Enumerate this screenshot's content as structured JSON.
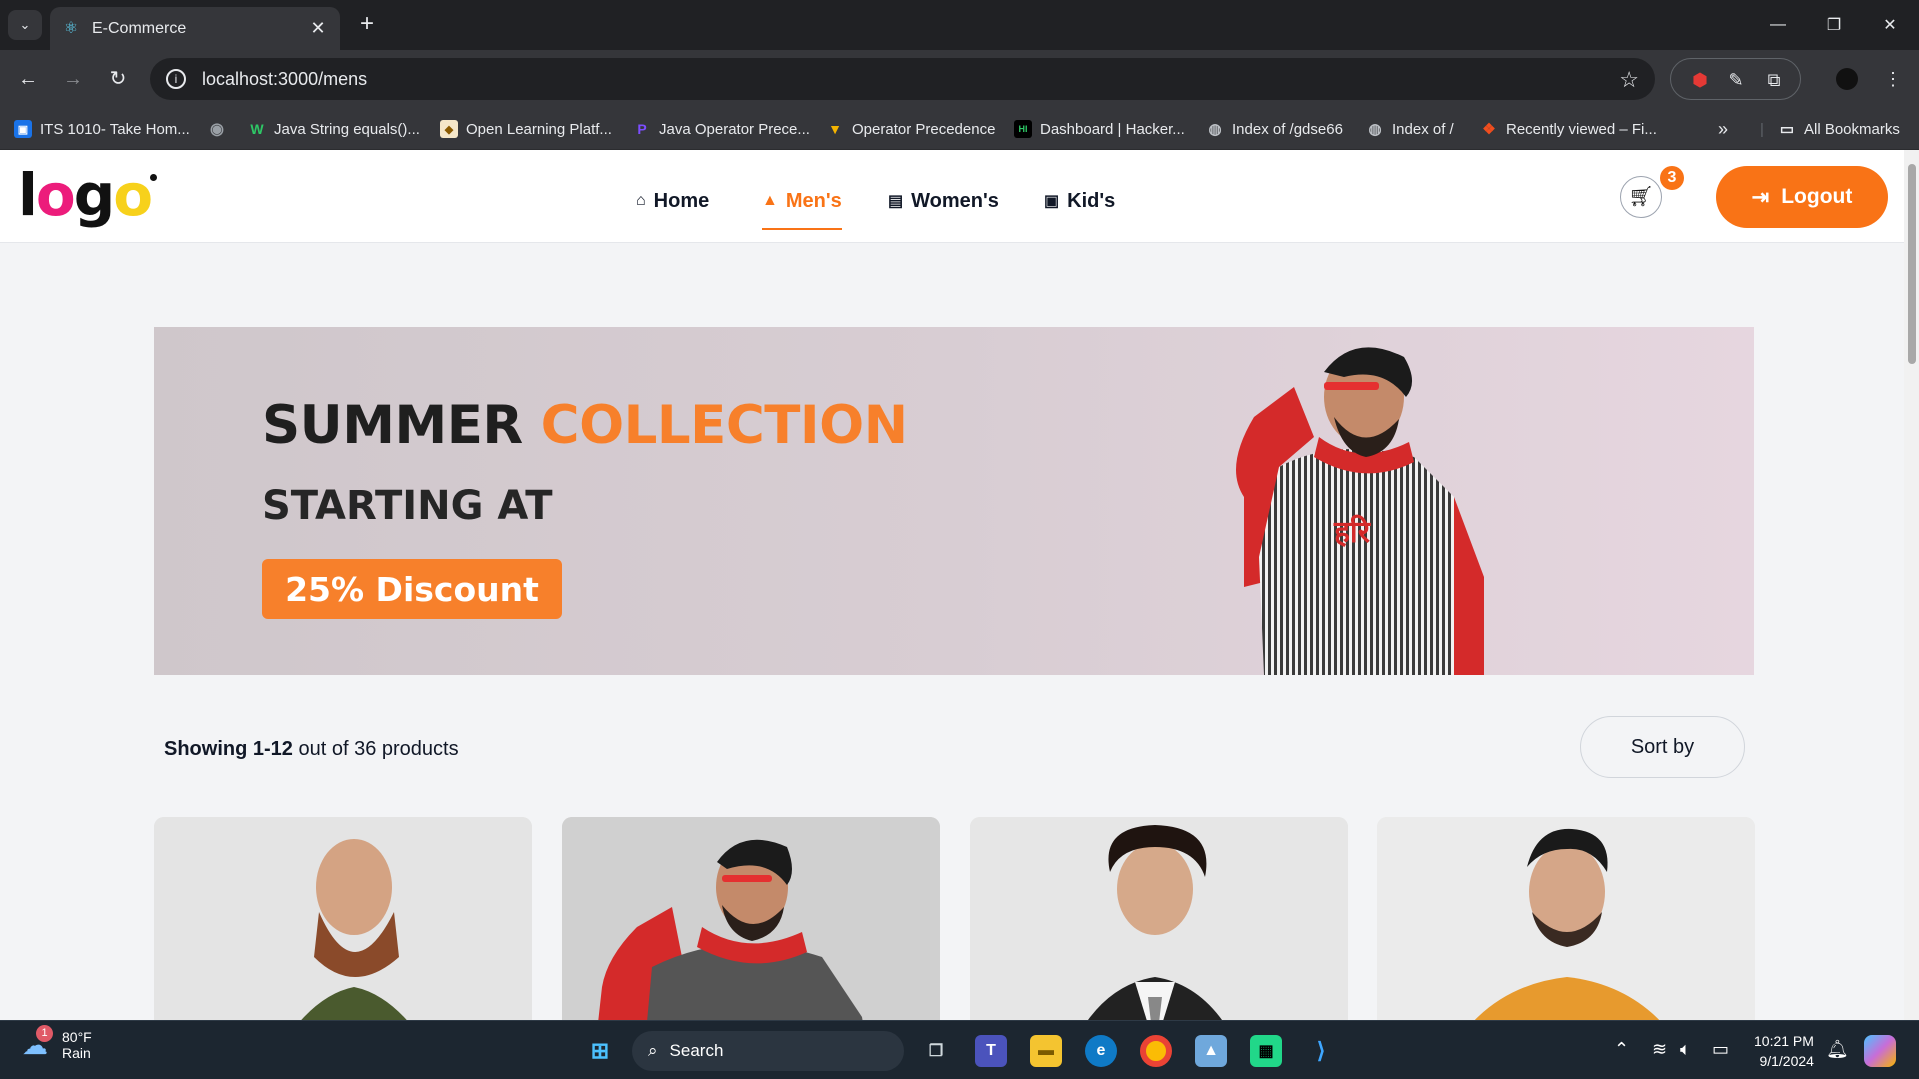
{
  "browser": {
    "tab_title": "E-Commerce",
    "url": "localhost:3000/mens",
    "bookmarks": [
      "ITS 1010- Take Hom...",
      "Java String equals()...",
      "Open Learning Platf...",
      "Java Operator Prece...",
      "Operator Precedence",
      "Dashboard | Hacker...",
      "Index of /gdse66",
      "Index of /",
      "Recently viewed – Fi..."
    ],
    "all_bookmarks": "All Bookmarks"
  },
  "site": {
    "logo": {
      "l": "l",
      "o1": "o",
      "g": "g",
      "o2": "o"
    },
    "nav": [
      "Home",
      "Men's",
      "Women's",
      "Kid's"
    ],
    "active_nav": "Men's",
    "cart_count": "3",
    "logout": "Logout"
  },
  "banner": {
    "line1_a": "SUMMER",
    "line1_b": "COLLECTION",
    "line2": "STARTING AT",
    "button": "25% Discount",
    "print_text": "हरि"
  },
  "listing": {
    "showing_bold": "Showing 1-12",
    "showing_rest": "out of 36 products",
    "sort": "Sort by"
  },
  "taskbar": {
    "weather_temp": "80°F",
    "weather_desc": "Rain",
    "weather_badge": "1",
    "search": "Search",
    "time": "10:21 PM",
    "date": "9/1/2024"
  },
  "colors": {
    "accent": "#f97316",
    "banner_accent": "#f7802b",
    "browser_dark": "#202124"
  }
}
